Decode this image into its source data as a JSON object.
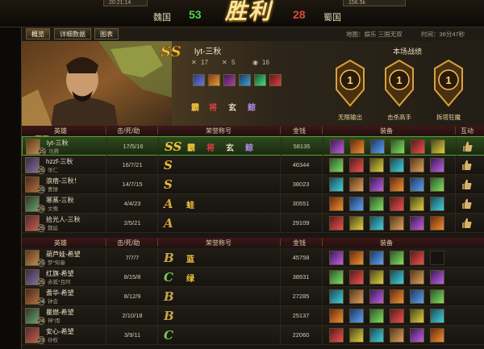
{
  "top": {
    "victory": "胜利",
    "team_left": "魏国",
    "score_left": "53",
    "team_right": "蜀国",
    "score_right": "28",
    "stub_left": "20:21:14",
    "stub_right": "156.5k"
  },
  "tabs": [
    "概览",
    "详细数据",
    "图表"
  ],
  "meta": {
    "map": "地图：娱乐 三国无双",
    "time": "时间：36分47秒"
  },
  "hero": {
    "player": "lyt-三秋",
    "grade": "SS",
    "kills": "17",
    "deaths": "5",
    "assists": "16",
    "honors": [
      "霸",
      "将",
      "玄",
      "鲸"
    ]
  },
  "performance": {
    "title": "本场战绩",
    "awards": [
      {
        "rank": "1",
        "label": "无限输出"
      },
      {
        "rank": "1",
        "label": "击杀高手"
      },
      {
        "rank": "1",
        "label": "拆塔狂魔"
      }
    ]
  },
  "mvp_hero_name": "马腾",
  "columns": {
    "hero": "英雄",
    "kda": "击/死/助",
    "honor": "荣誉称号",
    "gold": "金钱",
    "equip": "装备",
    "interact": "互动"
  },
  "team_wei": [
    {
      "name": "lyt-三秋",
      "hero": "马腾",
      "level": "25",
      "kda": "17/5/16",
      "grade": "SS",
      "gold": "58135",
      "honors": [
        "霸",
        "将",
        "玄",
        "鲸"
      ],
      "me": true
    },
    {
      "name": "hzzf-三秋",
      "hero": "张仁",
      "level": "25",
      "kda": "16/7/21",
      "grade": "S",
      "gold": "46344",
      "honors": [],
      "me": false
    },
    {
      "name": "浪痞-三秋！",
      "hero": "曹操",
      "level": "25",
      "kda": "14/7/15",
      "grade": "S",
      "gold": "38023",
      "honors": [],
      "me": false
    },
    {
      "name": "寒蒸-三秋",
      "hero": "文鸯",
      "level": "25",
      "kda": "4/4/23",
      "grade": "A",
      "gold": "30551",
      "honors": [
        "蛙"
      ],
      "me": false
    },
    {
      "name": "拾光人-三秋",
      "hero": "魏延",
      "level": "25",
      "kda": "2/5/21",
      "grade": "A",
      "gold": "29109",
      "honors": [],
      "me": false
    }
  ],
  "team_shu": [
    {
      "name": "葫芦娃-希望",
      "hero": "梦*知秦",
      "level": "25",
      "kda": "7/7/7",
      "grade": "B",
      "gold": "45758",
      "honors": [
        "蓝"
      ]
    },
    {
      "name": "红旗-希望",
      "hero": "赤狐*且阿",
      "level": "25",
      "kda": "8/15/8",
      "grade": "C",
      "gold": "38931",
      "honors": [
        "绿"
      ]
    },
    {
      "name": "耆华-希望",
      "hero": "钟会",
      "level": "24",
      "kda": "8/12/9",
      "grade": "B",
      "gold": "27285",
      "honors": []
    },
    {
      "name": "瞿燃-希望",
      "hero": "神*雨",
      "level": "24",
      "kda": "2/10/18",
      "grade": "B",
      "gold": "25137",
      "honors": []
    },
    {
      "name": "安心-希望",
      "hero": "孙权",
      "level": "23",
      "kda": "3/9/11",
      "grade": "C",
      "gold": "22060",
      "honors": []
    }
  ],
  "colors": {
    "ss": "#f3c23a",
    "s": "#e6b83b",
    "a": "#d9a53a",
    "b": "#c8a44a",
    "c": "#7cc94a"
  }
}
